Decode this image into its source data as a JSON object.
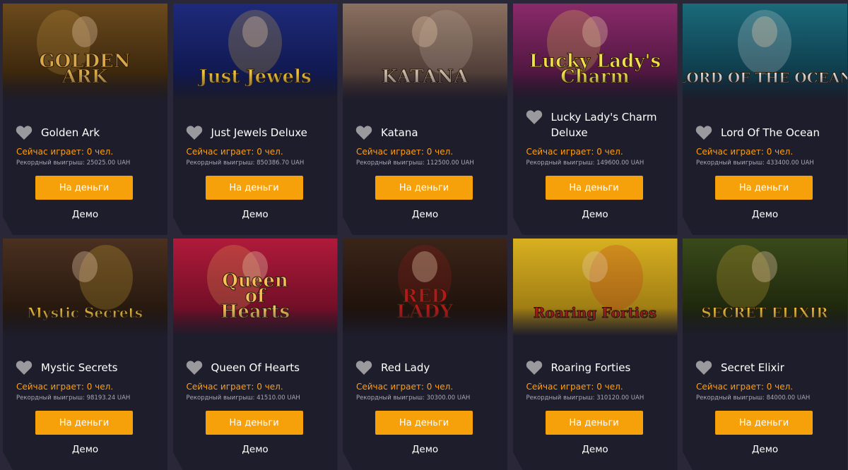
{
  "common": {
    "playing_text": "Сейчас играет: 0 чел.",
    "money_button": "На деньги",
    "demo_link": "Демо"
  },
  "games": [
    {
      "title": "Golden Ark",
      "record": "Рекордный выигрыш: 25025.00 UAH",
      "bg1": "#6b4a1c",
      "bg2": "#2a1a08",
      "accent": "#d9a84a",
      "art": "GOLDEN\nARK"
    },
    {
      "title": "Just Jewels Deluxe",
      "record": "Рекордный выигрыш: 850386.70 UAH",
      "bg1": "#1e2a7a",
      "bg2": "#0b1240",
      "accent": "#f0c23a",
      "art": "Just Jewels"
    },
    {
      "title": "Katana",
      "record": "Рекордный выигрыш: 112500.00 UAH",
      "bg1": "#8a7060",
      "bg2": "#3a2a28",
      "accent": "#c9b8a8",
      "art": "KATANA"
    },
    {
      "title": "Lucky Lady's Charm Deluxe",
      "record": "Рекордный выигрыш: 149600.00 UAH",
      "bg1": "#8a2a6a",
      "bg2": "#3a0f30",
      "accent": "#f2e04a",
      "art": "Lucky Lady's\nCharm"
    },
    {
      "title": "Lord Of The Ocean",
      "record": "Рекордный выигрыш: 433400.00 UAH",
      "bg1": "#1a6a7a",
      "bg2": "#0a2a3a",
      "accent": "#e6e6e6",
      "art": "LORD OF THE OCEAN"
    },
    {
      "title": "Mystic Secrets",
      "record": "Рекордный выигрыш: 98193.24 UAH",
      "bg1": "#4a3020",
      "bg2": "#1a1008",
      "accent": "#f2c23a",
      "art": "Mystic Secrets"
    },
    {
      "title": "Queen Of Hearts",
      "record": "Рекордный выигрыш: 41510.00 UAH",
      "bg1": "#b01a3a",
      "bg2": "#5a0a20",
      "accent": "#f8c05a",
      "art": "Queen\nof\nHearts"
    },
    {
      "title": "Red Lady",
      "record": "Рекордный выигрыш: 30300.00 UAH",
      "bg1": "#3a2418",
      "bg2": "#160c08",
      "accent": "#b01a1a",
      "art": "RED\nLADY"
    },
    {
      "title": "Roaring Forties",
      "record": "Рекордный выигрыш: 310120.00 UAH",
      "bg1": "#d8b020",
      "bg2": "#8a6a10",
      "accent": "#c01a1a",
      "art": "Roaring Forties"
    },
    {
      "title": "Secret Elixir",
      "record": "Рекордный выигрыш: 84000.00 UAH",
      "bg1": "#3a4a1a",
      "bg2": "#141a08",
      "accent": "#f2c23a",
      "art": "SECRET ELIXIR"
    }
  ]
}
